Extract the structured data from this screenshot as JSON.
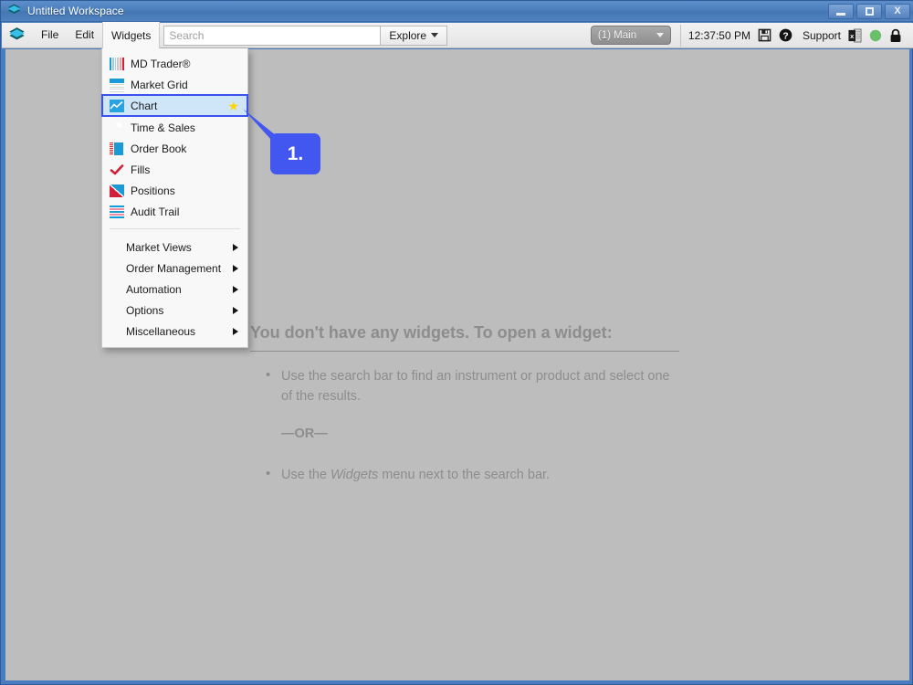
{
  "window": {
    "title": "Untitled Workspace",
    "controls": [
      {
        "name": "minimize",
        "label": ""
      },
      {
        "name": "maximize",
        "label": ""
      },
      {
        "name": "close",
        "label": "X"
      }
    ]
  },
  "toolbar": {
    "logo_icon": "app-diamond-logo",
    "menus": [
      {
        "label": "File",
        "active": false
      },
      {
        "label": "Edit",
        "active": false
      },
      {
        "label": "Widgets",
        "active": true
      }
    ],
    "search": {
      "value": "",
      "placeholder": "Search"
    },
    "explore": {
      "label": "Explore",
      "icon": "chevron-down-icon"
    },
    "workspace_selector": {
      "label": "(1) Main",
      "icon": "chevron-down-icon"
    },
    "clock": "12:37:50 PM",
    "save_icon": "floppy-save-icon",
    "support": {
      "label": "Support",
      "icon": "question-mark-icon"
    },
    "excel_icon": "excel-export-icon",
    "status_icon": "green-status-circle",
    "lock_icon": "padlock-icon"
  },
  "menu": {
    "widget_items": [
      {
        "label": "MD Trader®",
        "icon": "md-trader-icon",
        "selected": false,
        "starred": false
      },
      {
        "label": "Market Grid",
        "icon": "market-grid-icon",
        "selected": false,
        "starred": false
      },
      {
        "label": "Chart",
        "icon": "chart-icon",
        "selected": true,
        "starred": true
      },
      {
        "label": "Time & Sales",
        "icon": "time-and-sales-icon",
        "selected": false,
        "starred": false
      },
      {
        "label": "Order Book",
        "icon": "order-book-icon",
        "selected": false,
        "starred": false
      },
      {
        "label": "Fills",
        "icon": "fills-checkmark-icon",
        "selected": false,
        "starred": false
      },
      {
        "label": "Positions",
        "icon": "positions-icon",
        "selected": false,
        "starred": false
      },
      {
        "label": "Audit Trail",
        "icon": "audit-trail-icon",
        "selected": false,
        "starred": false
      }
    ],
    "submenu_items": [
      {
        "label": "Market Views",
        "icon": "chevron-right-icon"
      },
      {
        "label": "Order Management",
        "icon": "chevron-right-icon"
      },
      {
        "label": "Automation",
        "icon": "chevron-right-icon"
      },
      {
        "label": "Options",
        "icon": "chevron-right-icon"
      },
      {
        "label": "Miscellaneous",
        "icon": "chevron-right-icon"
      }
    ]
  },
  "callout": {
    "label": "1."
  },
  "empty_state": {
    "heading": "You don't have any widgets. To open a widget:",
    "bullet_one": "Use the search bar to find an instrument or product and select one of the results.",
    "or_text": "—OR—",
    "bullet_two_prefix": "Use the ",
    "bullet_two_emphasis": "Widgets",
    "bullet_two_suffix": " menu next to the search bar."
  },
  "colors": {
    "titlebar_blue": "#4a7ebb",
    "workspace_gray": "#bdbdbd",
    "selection_fill": "#cfe6f9",
    "selection_border": "#3a52ef",
    "callout_blue": "#4257ef",
    "star_yellow": "#ffd400",
    "accent_cyan": "#1c9ad6",
    "accent_red": "#d0213b",
    "status_green": "#6abf6a"
  }
}
